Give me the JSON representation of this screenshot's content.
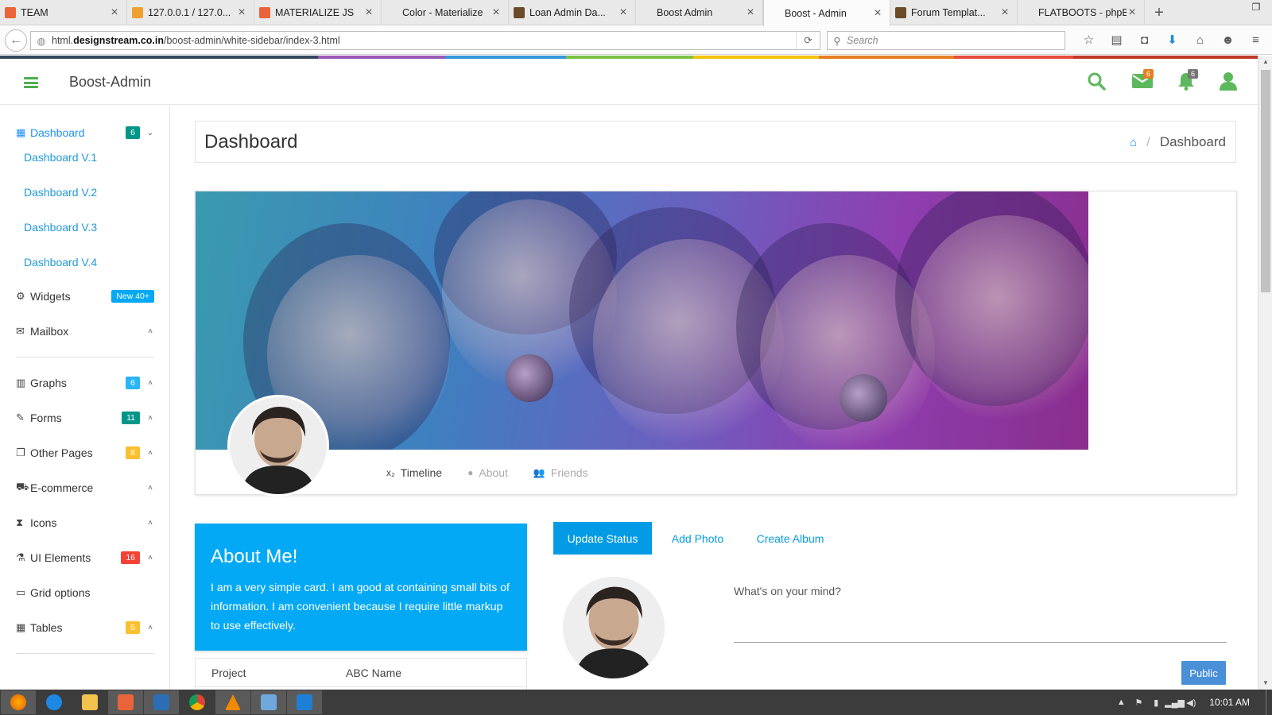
{
  "browser": {
    "tabs": [
      {
        "title": "TEAM",
        "favicon_color": "#e9643b"
      },
      {
        "title": "127.0.0.1 / 127.0...",
        "favicon_color": "#f0a030"
      },
      {
        "title": "MATERIALIZE JS",
        "favicon_color": "#e9643b"
      },
      {
        "title": "Color - Materialize",
        "favicon_color": ""
      },
      {
        "title": "Loan Admin Da...",
        "favicon_color": "#6b4a2a"
      },
      {
        "title": "Boost Admin",
        "favicon_color": ""
      },
      {
        "title": "Boost - Admin",
        "favicon_color": "",
        "active": true
      },
      {
        "title": "Forum Templat...",
        "favicon_color": "#6b4a2a"
      },
      {
        "title": "FLATBOOTS - phpB...",
        "favicon_color": ""
      }
    ],
    "url_prefix": "html.",
    "url_domain": "designstream.co.in",
    "url_path": "/boost-admin/white-sidebar/index-3.html",
    "search_placeholder": "Search"
  },
  "header": {
    "brand": "Boost-Admin",
    "messages_count": "6",
    "notifications_count": "6",
    "accent_color": "#5cb85c"
  },
  "sidebar": {
    "dashboard": {
      "label": "Dashboard",
      "badge": "6",
      "badge_color": "#009688"
    },
    "dashboard_subs": [
      "Dashboard V.1",
      "Dashboard V.2",
      "Dashboard V.3",
      "Dashboard V.4"
    ],
    "widgets": {
      "label": "Widgets",
      "badge": "New 40+",
      "badge_color": "#03a9f4"
    },
    "mailbox": {
      "label": "Mailbox"
    },
    "graphs": {
      "label": "Graphs",
      "badge": "6",
      "badge_color": "#29b6f6"
    },
    "forms": {
      "label": "Forms",
      "badge": "11",
      "badge_color": "#009688"
    },
    "other_pages": {
      "label": "Other Pages",
      "badge": "8",
      "badge_color": "#fbc02d"
    },
    "ecommerce": {
      "label": "E-commerce"
    },
    "icons": {
      "label": "Icons"
    },
    "ui_elements": {
      "label": "UI Elements",
      "badge": "16",
      "badge_color": "#f44336"
    },
    "grid_options": {
      "label": "Grid options"
    },
    "tables": {
      "label": "Tables",
      "badge": "5",
      "badge_color": "#fbc02d"
    }
  },
  "main": {
    "page_title": "Dashboard",
    "breadcrumb_current": "Dashboard",
    "profile_tabs": [
      "Timeline",
      "About",
      "Friends"
    ],
    "about": {
      "title": "About Me!",
      "text": "I am a very simple card. I am good at containing small bits of information. I am convenient because I require little markup to use effectively."
    },
    "info_table": [
      {
        "key": "Project",
        "value": "ABC Name"
      }
    ],
    "actions": [
      "Update Status",
      "Add Photo",
      "Create Album"
    ],
    "status_prompt": "What's on your mind?",
    "public_button": "Public"
  },
  "taskbar": {
    "clock": "10:01 AM"
  }
}
